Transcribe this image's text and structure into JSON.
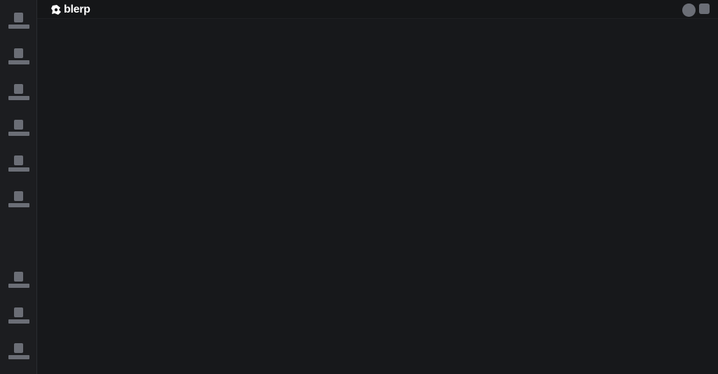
{
  "header": {
    "logo_text": "blerp",
    "logo_icon": "blerp-logo-icon",
    "avatar_icon": "avatar-circle-icon",
    "menu_icon": "square-menu-icon"
  },
  "sidebar": {
    "items": [
      {
        "icon": "placeholder-user-icon"
      },
      {
        "icon": "placeholder-user-icon"
      },
      {
        "icon": "placeholder-user-icon"
      },
      {
        "icon": "placeholder-user-icon"
      },
      {
        "icon": "placeholder-user-icon"
      },
      {
        "icon": "placeholder-user-icon"
      },
      {
        "icon": "placeholder-user-icon"
      },
      {
        "icon": "placeholder-user-icon"
      },
      {
        "icon": "placeholder-user-icon"
      }
    ]
  },
  "colors": {
    "background": "#17181b",
    "sidebar": "#1c1d20",
    "topbar": "#151618",
    "placeholder": "#6b6e76",
    "logo_text": "#ffffff"
  }
}
